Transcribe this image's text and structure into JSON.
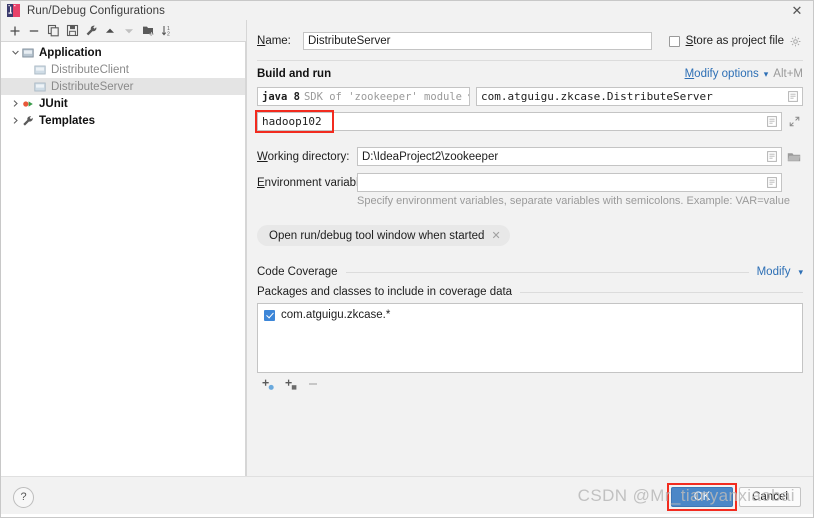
{
  "window": {
    "title": "Run/Debug Configurations",
    "close_label": "✕",
    "app_icon": "intellij-idea-icon"
  },
  "left_panel": {
    "toolbar": [
      {
        "name": "add-configuration-button",
        "icon": "plus-icon",
        "label": "+"
      },
      {
        "name": "remove-configuration-button",
        "icon": "minus-icon",
        "label": "−"
      },
      {
        "name": "copy-configuration-button",
        "icon": "copy-icon",
        "label": ""
      },
      {
        "name": "save-configuration-button",
        "icon": "save-icon",
        "label": ""
      },
      {
        "name": "edit-templates-button",
        "icon": "wrench-icon",
        "label": ""
      },
      {
        "name": "move-up-button",
        "icon": "arrow-up-icon",
        "label": ""
      },
      {
        "name": "move-down-button",
        "icon": "arrow-down-icon",
        "label": ""
      },
      {
        "name": "move-into-folder-button",
        "icon": "folder-add-icon",
        "label": ""
      },
      {
        "name": "sort-configurations-button",
        "icon": "sort-az-icon",
        "label": ""
      }
    ],
    "tree": [
      {
        "label": "Application",
        "icon": "application-icon",
        "twisty": "expanded",
        "level": 0,
        "style": "bold",
        "selected": false
      },
      {
        "label": "DistributeClient",
        "icon": "run-config-icon",
        "twisty": "none",
        "level": 1,
        "style": "muted",
        "selected": false
      },
      {
        "label": "DistributeServer",
        "icon": "run-config-icon",
        "twisty": "none",
        "level": 1,
        "style": "muted",
        "selected": true
      },
      {
        "label": "JUnit",
        "icon": "junit-icon",
        "twisty": "collapsed",
        "level": 0,
        "style": "bold",
        "selected": false
      },
      {
        "label": "Templates",
        "icon": "wrench-icon",
        "twisty": "collapsed",
        "level": 0,
        "style": "bold",
        "selected": false
      }
    ]
  },
  "form": {
    "name_label": "Name:",
    "name_value": "DistributeServer",
    "store_as_project_file_label": "Store as project file",
    "store_as_project_file_checked": false,
    "store_gear_icon": "gear-icon",
    "build_and_run_title": "Build and run",
    "modify_options_label": "Modify options",
    "modify_options_shortcut": "Alt+M",
    "jdk_bold": "java 8",
    "jdk_rest": "SDK of 'zookeeper' module",
    "main_class": "com.atguigu.zkcase.DistributeServer",
    "program_arguments": "hadoop102",
    "working_directory_label": "Working directory:",
    "working_directory_value": "D:\\IdeaProject2\\zookeeper",
    "environment_variables_label": "Environment variables:",
    "environment_variables_value": "",
    "environment_hint": "Specify environment variables, separate variables with semicolons. Example: VAR=value",
    "chip_label": "Open run/debug tool window when started",
    "chip_close_icon": "close-icon",
    "code_coverage_title": "Code Coverage",
    "code_coverage_modify_label": "Modify",
    "packages_caption": "Packages and classes to include in coverage data",
    "coverage_items": [
      {
        "label": "com.atguigu.zkcase.*",
        "checked": true
      }
    ],
    "coverage_toolbar": [
      {
        "name": "add-package-button",
        "icon": "add-package-icon"
      },
      {
        "name": "add-class-button",
        "icon": "add-class-icon"
      },
      {
        "name": "remove-pattern-button",
        "icon": "minus-icon"
      }
    ]
  },
  "footer": {
    "help_label": "?",
    "ok_label": "OK",
    "cancel_label": "Cancel"
  },
  "annotations": {
    "highlight_color": "#f22b1f",
    "boxes": [
      "program-arguments-field",
      "ok-button"
    ]
  },
  "watermark": {
    "text": "CSDN @Mr_tianyanxiaobai"
  }
}
